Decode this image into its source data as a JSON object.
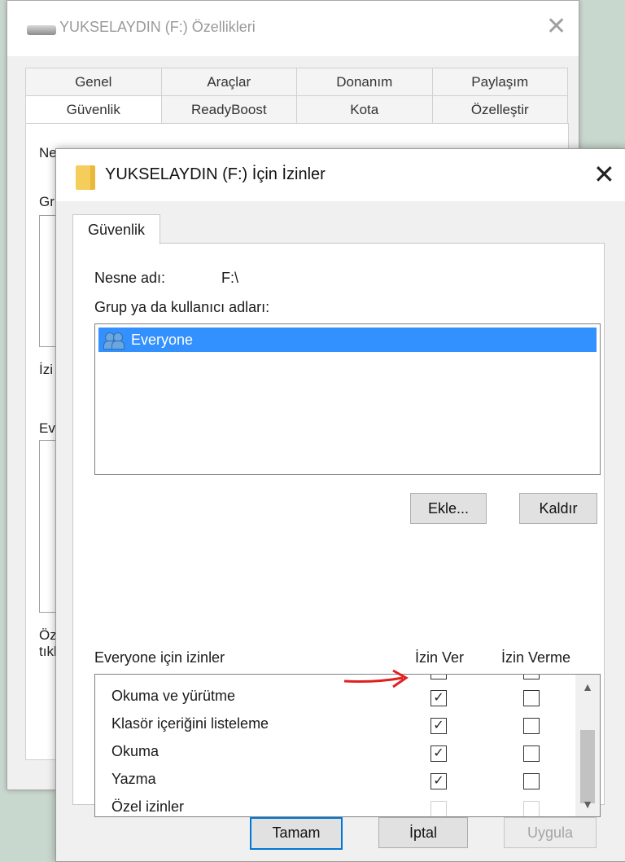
{
  "background_window": {
    "title": "YUKSELAYDIN (F:) Özellikleri",
    "tabs_row1": [
      "Genel",
      "Araçlar",
      "Donanım",
      "Paylaşım"
    ],
    "tabs_row2": [
      "Güvenlik",
      "ReadyBoost",
      "Kota",
      "Özelleştir"
    ],
    "fragments": {
      "ne": "Ne",
      "gr": "Gr",
      "izi": "İzi",
      "ev": "Ev",
      "oz": "Öz",
      "tik": "tıkl"
    }
  },
  "dialog": {
    "title": "YUKSELAYDIN (F:) İçin İzinler",
    "close_glyph": "✕",
    "tab": "Güvenlik",
    "object_name_label": "Nesne adı:",
    "object_name_value": "F:\\",
    "group_label": "Grup ya da kullanıcı adları:",
    "users": [
      {
        "name": "Everyone",
        "selected": true
      }
    ],
    "add_button": "Ekle...",
    "remove_button": "Kaldır",
    "perm_header": "Everyone için izinler",
    "allow_header": "İzin Ver",
    "deny_header": "İzin Verme",
    "permissions": [
      {
        "name": "Okuma ve yürütme",
        "allow": true,
        "deny": false,
        "enabled": true
      },
      {
        "name": "Klasör içeriğini listeleme",
        "allow": true,
        "deny": false,
        "enabled": true
      },
      {
        "name": "Okuma",
        "allow": true,
        "deny": false,
        "enabled": true
      },
      {
        "name": "Yazma",
        "allow": true,
        "deny": false,
        "enabled": true
      },
      {
        "name": "Özel izinler",
        "allow": false,
        "deny": false,
        "enabled": false
      }
    ],
    "ok_button": "Tamam",
    "cancel_button": "İptal",
    "apply_button": "Uygula"
  },
  "colors": {
    "selection": "#3390ff",
    "annotation_arrow": "#e0201e"
  }
}
